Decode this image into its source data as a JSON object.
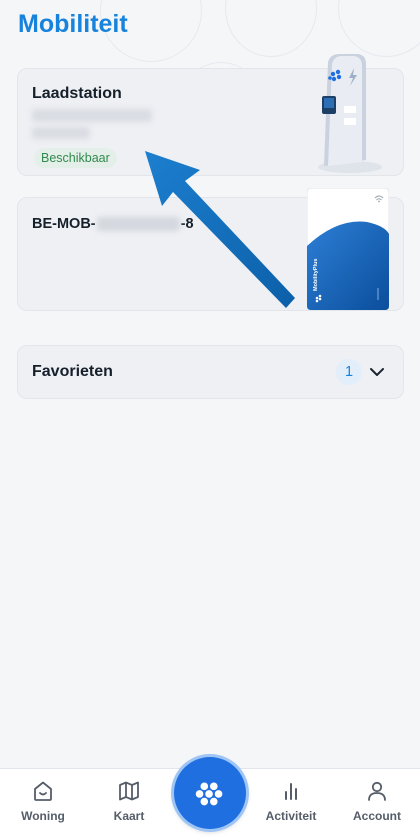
{
  "header": {
    "title": "Mobiliteit"
  },
  "charger_card": {
    "title": "Laadstation",
    "address_line1": "",
    "address_line2": "",
    "status": "Beschikbaar",
    "status_color": "#2f8a4c",
    "image_icon": "charging-station-icon"
  },
  "card_card": {
    "card_number_prefix": "BE-MOB-",
    "card_number_suffix": "-8",
    "image_icon": "charge-card-icon",
    "card_brand": "MobilityPlus"
  },
  "favorites": {
    "label": "Favorieten",
    "count": "1",
    "icon": "chevron-down-icon"
  },
  "accent_color": "#1883dc",
  "fab": {
    "icon": "mobility-logo-icon"
  },
  "nav": {
    "items": [
      {
        "label": "Woning",
        "icon": "home-icon"
      },
      {
        "label": "Kaart",
        "icon": "map-icon"
      },
      {
        "label": "Activiteit",
        "icon": "activity-icon"
      },
      {
        "label": "Account",
        "icon": "user-icon"
      }
    ]
  }
}
